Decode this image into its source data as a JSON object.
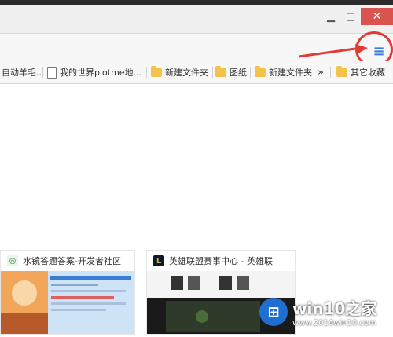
{
  "window": {
    "minimize_glyph": "▁",
    "maximize_glyph": "□",
    "close_glyph": "✕"
  },
  "menu": {
    "glyph": "≡",
    "icon": "hamburger-menu-icon"
  },
  "bookmarks": {
    "items": [
      {
        "label": "自动羊毛...",
        "icon": "page-icon"
      },
      {
        "label": "我的世界plotme地...",
        "icon": "page-icon"
      },
      {
        "label": "新建文件夹",
        "icon": "folder-icon"
      },
      {
        "label": "图纸",
        "icon": "folder-icon"
      },
      {
        "label": "新建文件夹",
        "icon": "folder-icon"
      }
    ],
    "overflow_glyph": "»",
    "other_label": "其它收藏"
  },
  "thumbnails": [
    {
      "title": "水镜答题答案-开发者社区",
      "icon_glyph": "◎"
    },
    {
      "title": "英雄联盟赛事中心 - 英雄联",
      "icon_glyph": "L"
    }
  ],
  "watermark": {
    "title": "win10之家",
    "url": "www.2016win10.com"
  },
  "colors": {
    "accent": "#3a7bd5",
    "close": "#d9534f",
    "annotation": "#e53935",
    "folder": "#f3c24a"
  }
}
